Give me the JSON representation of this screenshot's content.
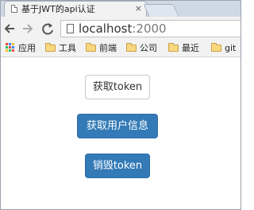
{
  "browser": {
    "tab": {
      "title": "基于JWT的api认证",
      "close_glyph": "×"
    },
    "address_bar": {
      "host": "localhost",
      "port": ":2000"
    },
    "bookmarks": [
      {
        "label": "应用",
        "icon": "apps-grid-icon"
      },
      {
        "label": "工具",
        "icon": "folder-icon"
      },
      {
        "label": "前端",
        "icon": "folder-icon"
      },
      {
        "label": "公司",
        "icon": "folder-icon"
      },
      {
        "label": "最近",
        "icon": "folder-icon"
      },
      {
        "label": "git",
        "icon": "folder-icon"
      }
    ]
  },
  "page": {
    "buttons": {
      "get_token": "获取token",
      "get_user_info": "获取用户信息",
      "logout_token": "销毁token"
    }
  },
  "colors": {
    "primary": "#337ab7",
    "primary_border": "#2e6da4",
    "default_border": "#c8c8c8",
    "folder": "#f9d77e"
  }
}
